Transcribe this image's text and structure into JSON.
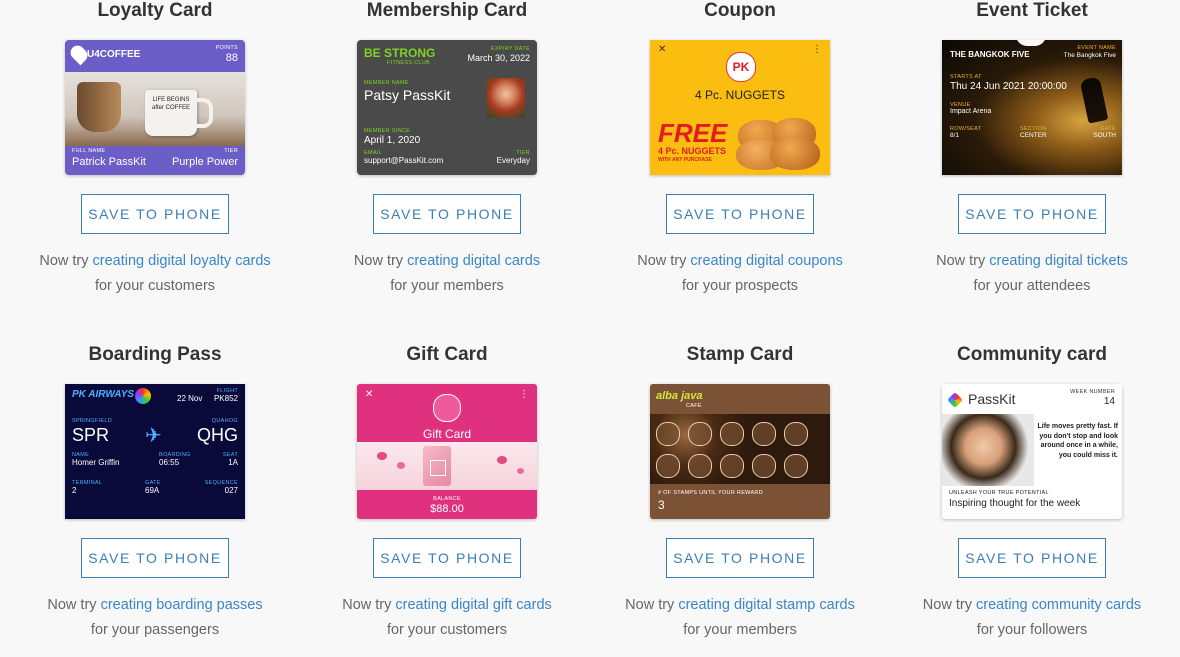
{
  "tiles": [
    {
      "title": "Loyalty Card",
      "button": "SAVE TO PHONE",
      "prefix": "Now try",
      "link": "creating digital loyalty cards",
      "suffix": "for your customers"
    },
    {
      "title": "Membership Card",
      "button": "SAVE TO PHONE",
      "prefix": "Now try",
      "link": "creating digital cards",
      "suffix": "for your members"
    },
    {
      "title": "Coupon",
      "button": "SAVE TO PHONE",
      "prefix": "Now try",
      "link": "creating digital coupons",
      "suffix": "for your prospects"
    },
    {
      "title": "Event Ticket",
      "button": "SAVE TO PHONE",
      "prefix": "Now try",
      "link": "creating digital tickets",
      "suffix": "for your attendees"
    },
    {
      "title": "Boarding Pass",
      "button": "SAVE TO PHONE",
      "prefix": "Now try",
      "link": "creating boarding passes",
      "suffix": "for your passengers"
    },
    {
      "title": "Gift Card",
      "button": "SAVE TO PHONE",
      "prefix": "Now try",
      "link": "creating digital gift cards",
      "suffix": "for your customers"
    },
    {
      "title": "Stamp Card",
      "button": "SAVE TO PHONE",
      "prefix": "Now try",
      "link": "creating digital stamp cards",
      "suffix": "for your members"
    },
    {
      "title": "Community card",
      "button": "SAVE TO PHONE",
      "prefix": "Now try",
      "link": "creating community cards",
      "suffix": "for your followers"
    }
  ],
  "cards": {
    "loyalty": {
      "brand": "U4COFFEE",
      "points_label": "POINTS",
      "points": "88",
      "mug_text": "LIFE BEGINS after COFFEE",
      "name_label": "FULL NAME",
      "name": "Patrick PassKit",
      "tier_label": "TIER",
      "tier": "Purple Power"
    },
    "membership": {
      "brand": "BE STRONG",
      "brand_sub": "FITNESS CLUB",
      "expiry_label": "EXPIRY DATE",
      "expiry": "March 30, 2022",
      "member_label": "MEMBER NAME",
      "member": "Patsy PassKit",
      "since_label": "MEMBER SINCE",
      "since": "April 1, 2020",
      "email_label": "EMAIL",
      "email": "support@PassKit.com",
      "tier_label": "TIER",
      "tier": "Everyday"
    },
    "coupon": {
      "logo": "PK",
      "offer": "4 Pc. NUGGETS",
      "free": "FREE",
      "free_sub": "4 Pc. NUGGETS",
      "free_sub2": "WITH ANY PURCHASE"
    },
    "event": {
      "band": "THE BANGKOK FIVE",
      "event_label": "EVENT NAME",
      "event": "The Bangkok Five",
      "starts_label": "STARTS AT",
      "starts": "Thu 24 Jun 2021 20:00:00",
      "venue_label": "VENUE",
      "venue": "Impact Arena",
      "row_label": "ROW/SEAT",
      "row": "8/1",
      "section_label": "SECTION",
      "section": "CENTER",
      "gate_label": "GATE",
      "gate": "SOUTH"
    },
    "boarding": {
      "airline": "PK AIRWAYS",
      "date": "22 Nov",
      "flight_label": "FLIGHT",
      "flight": "PK852",
      "from_city": "SPRINGFIELD",
      "from": "SPR",
      "to_city": "QUAHOG",
      "to": "QHG",
      "name_label": "NAME",
      "name": "Homer Griffin",
      "boarding_label": "BOARDING",
      "boarding": "06:55",
      "seat_label": "SEAT",
      "seat": "1A",
      "terminal_label": "TERMINAL",
      "terminal": "2",
      "gate_label": "GATE",
      "gate": "69A",
      "sequence_label": "SEQUENCE",
      "sequence": "027"
    },
    "gift": {
      "title": "Gift Card",
      "balance_label": "BALANCE",
      "balance": "$88.00"
    },
    "stamp": {
      "brand": "alba java",
      "brand_sub": "CAFE",
      "count_label": "# OF STAMPS UNTIL YOUR REWARD",
      "count": "3"
    },
    "community": {
      "brand": "PassKit",
      "week_label": "WEEK NUMBER",
      "week": "14",
      "quote": "Life moves pretty fast. If you don't stop and look around once in a while, you could miss it.",
      "tag_label": "UNLEASH YOUR TRUE POTENTIAL",
      "tag": "Inspiring thought for the week"
    }
  },
  "colors": {
    "accent": "#3a7fb5",
    "link": "#3a86c8",
    "loyalty": "#6b5fc7",
    "membership": "#4a4a4a",
    "coupon": "#fbbd10",
    "boarding": "#0a0a3a",
    "gift": "#e0317f",
    "stamp": "#7b5235"
  }
}
